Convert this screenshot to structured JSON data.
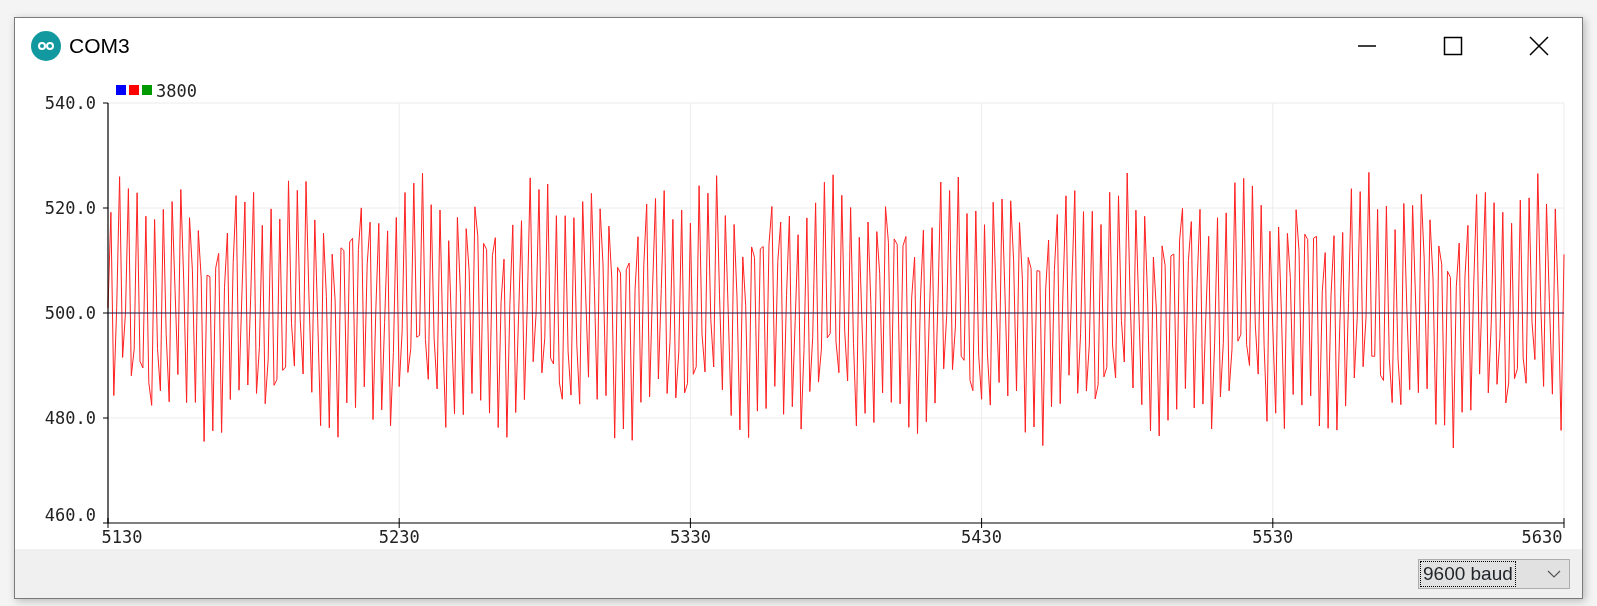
{
  "window": {
    "title": "COM3"
  },
  "plot": {
    "legend": {
      "swatches": [
        {
          "color": "#0000ff"
        },
        {
          "color": "#ff0000"
        },
        {
          "color": "#009900"
        }
      ],
      "label": "3800"
    },
    "y_axis_labels": [
      "540.0",
      "520.0",
      "500.0",
      "480.0",
      "460.0"
    ],
    "x_axis_labels": [
      "5130",
      "5230",
      "5330",
      "5430",
      "5530",
      "5630"
    ]
  },
  "footer": {
    "baud_rate": {
      "value": "9600 baud"
    }
  }
}
